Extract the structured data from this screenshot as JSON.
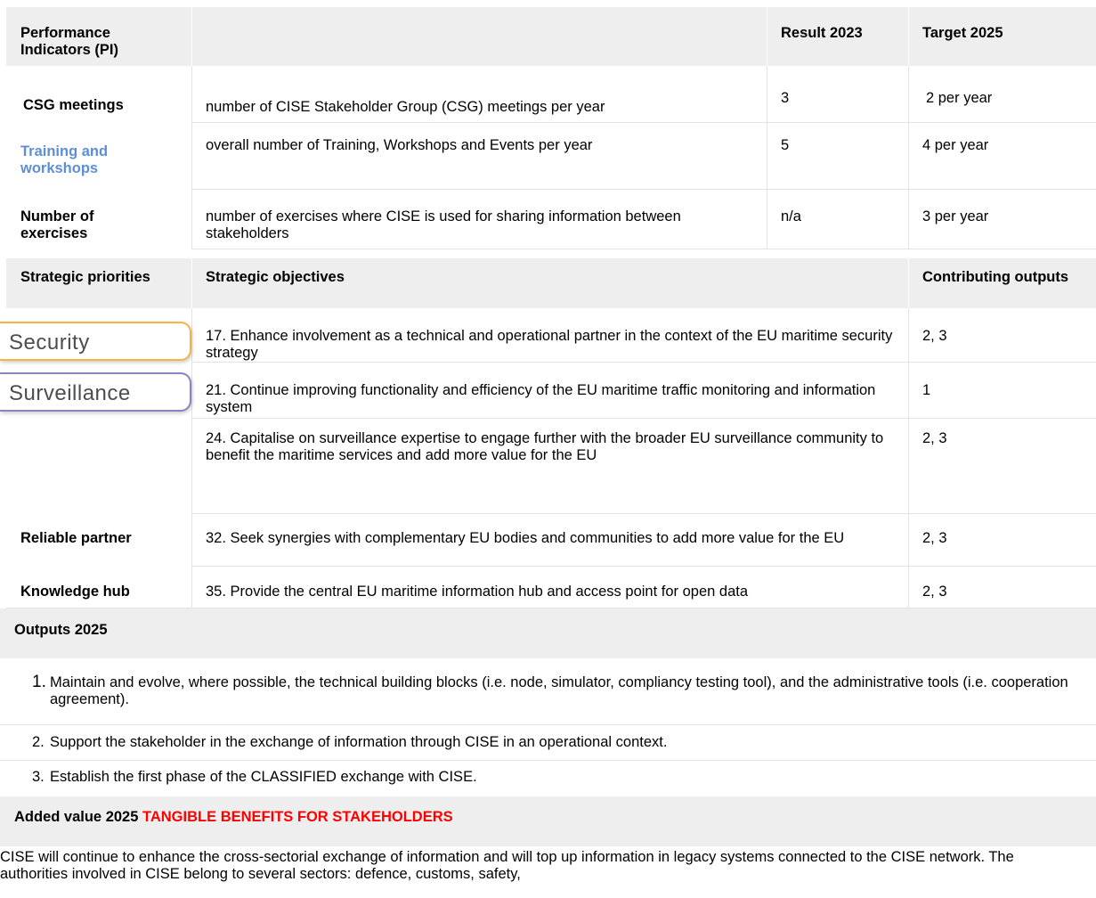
{
  "pi_table": {
    "header": {
      "indicators": "Performance Indicators (PI)",
      "result": "Result 2023",
      "target": "Target 2025"
    },
    "rows": [
      {
        "name": "CSG meetings",
        "description": "number of CISE Stakeholder Group (CSG) meetings per year",
        "result": "3",
        "target": "2 per year"
      },
      {
        "name": "Training and workshops",
        "description": "overall number of Training, Workshops and Events per year",
        "result": "5",
        "target": "4 per year"
      },
      {
        "name": "Number of exercises",
        "description": "number of exercises where CISE is used for sharing information between stakeholders",
        "result": "n/a",
        "target": "3 per year"
      }
    ]
  },
  "strategy_table": {
    "header": {
      "priorities": "Strategic priorities",
      "objectives": "Strategic objectives",
      "outputs": "Contributing outputs"
    },
    "rows": [
      {
        "priority": "Security",
        "objective": "17. Enhance involvement as a technical and operational partner in the context of the EU maritime security strategy",
        "outputs": "2, 3"
      },
      {
        "priority": "Surveillance",
        "objective": "21. Continue improving functionality and efficiency of the EU maritime traffic monitoring and information system",
        "outputs": "1"
      },
      {
        "priority": "",
        "objective": "24. Capitalise on surveillance expertise to engage further with the broader EU surveillance community to benefit the maritime services and add more value for the EU",
        "outputs": "2, 3"
      },
      {
        "priority": "Reliable partner",
        "objective": "32. Seek synergies with complementary EU bodies and communities to add more value for the EU",
        "outputs": "2, 3"
      },
      {
        "priority": "Knowledge hub",
        "objective": "35. Provide the central EU maritime information hub and access point for open data",
        "outputs": "2, 3"
      }
    ]
  },
  "outputs": {
    "title": "Outputs 2025",
    "items": [
      {
        "num": "1.",
        "text": "Maintain and evolve, where possible, the technical building blocks (i.e. node, simulator, compliancy testing tool), and the administrative tools (i.e. cooperation agreement)."
      },
      {
        "num": "2.",
        "text": "Support the stakeholder in the exchange of information through CISE in an operational context."
      },
      {
        "num": "3.",
        "text": "Establish the first phase of the CLASSIFIED exchange with CISE."
      }
    ]
  },
  "added_value": {
    "title": "Added value 2025",
    "highlight": "TANGIBLE BENEFITS FOR STAKEHOLDERS",
    "highlight_color": "#ff0000",
    "body": "CISE will continue to enhance the cross-sectorial exchange of information and will top up information in legacy systems connected to the CISE network. The authorities involved in CISE belong to several sectors: defence, customs, safety,"
  },
  "colors": {
    "link_blue": "#5b8fd6",
    "security_border": "#f4b547",
    "surveillance_border": "#8d83be",
    "grey_bg": "#eeeeee"
  }
}
